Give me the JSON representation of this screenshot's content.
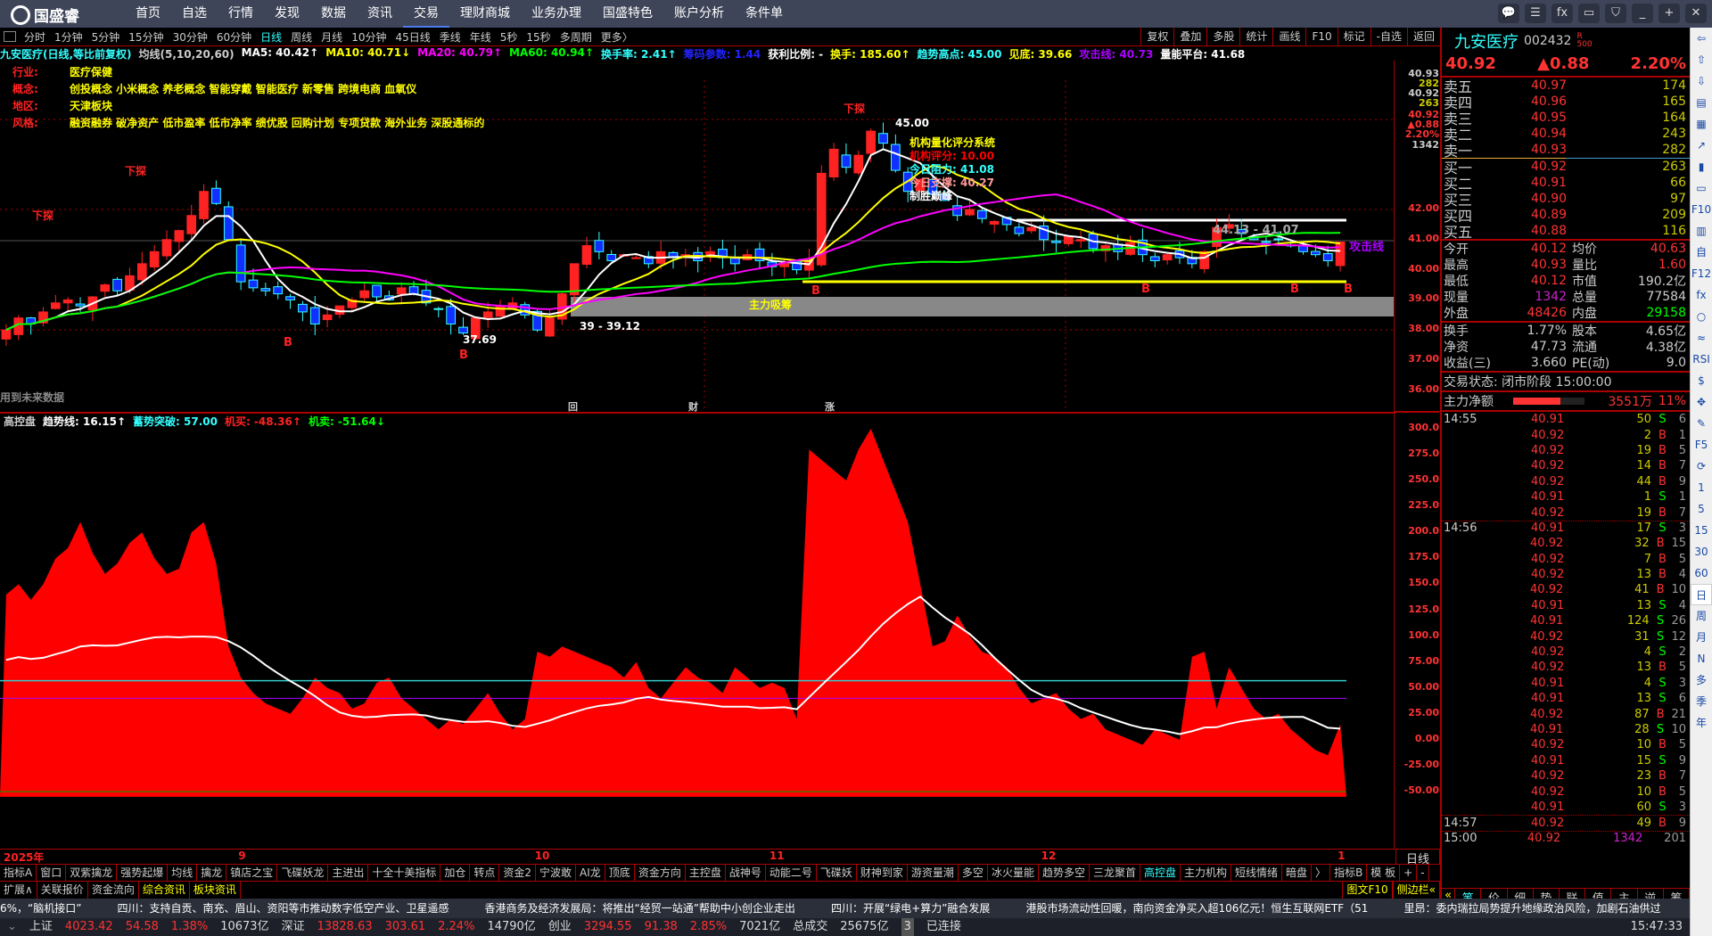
{
  "app": {
    "logo": "国盛睿",
    "nav": [
      "首页",
      "自选",
      "行情",
      "发现",
      "数据",
      "资讯",
      "交易",
      "理财商城",
      "业务办理",
      "国盛特色",
      "账户分析",
      "条件单"
    ],
    "active_nav": 6,
    "window_buttons": [
      "chat-icon",
      "settings-icon",
      "fx-icon",
      "monitor-icon",
      "shirt-icon",
      "minimize-icon",
      "restore-icon",
      "close-icon"
    ]
  },
  "periods": {
    "items": [
      "分时",
      "1分钟",
      "5分钟",
      "15分钟",
      "30分钟",
      "60分钟",
      "日线",
      "周线",
      "月线",
      "10分钟",
      "45日线",
      "季线",
      "年线",
      "5秒",
      "15秒",
      "多周期",
      "更多〉"
    ],
    "active": 6
  },
  "tools": [
    "复权",
    "叠加",
    "多股",
    "统计",
    "画线",
    "F10",
    "标记",
    "-自选",
    "返回"
  ],
  "infoline": [
    {
      "t": "九安医疗(日线,等比前复权)",
      "c": "#3ff"
    },
    {
      "t": "均线(5,10,20,60)",
      "c": "#ccc"
    },
    {
      "t": "MA5: 40.42↑",
      "c": "#fff"
    },
    {
      "t": "MA10: 40.71↓",
      "c": "#ff0"
    },
    {
      "t": "MA20: 40.79↑",
      "c": "#f0f"
    },
    {
      "t": "MA60: 40.94↑",
      "c": "#0f0"
    },
    {
      "t": "换手率: 2.41↑",
      "c": "#3ff"
    },
    {
      "t": "筹码参数: 1.44",
      "c": "#22f"
    },
    {
      "t": "获利比例: -",
      "c": "#fff"
    },
    {
      "t": "换手: 185.60↑",
      "c": "#ff0"
    },
    {
      "t": "趋势高点: 45.00",
      "c": "#3ff"
    },
    {
      "t": "见底: 39.66",
      "c": "#ff0"
    },
    {
      "t": "攻击线: 40.73",
      "c": "#a0f"
    },
    {
      "t": "量能平台: 41.68",
      "c": "#fff"
    }
  ],
  "tags": [
    {
      "k": "行业:",
      "v": "医疗保健"
    },
    {
      "k": "概念:",
      "v": "创投概念 小米概念 养老概念 智能穿戴 智能医疗 新零售 跨境电商 血氧仪"
    },
    {
      "k": "地区:",
      "v": "天津板块"
    },
    {
      "k": "风格:",
      "v": "融资融券 破净资产 低市盈率 低市净率 绩优股 回购计划 专项贷款 海外业务 深股通标的"
    }
  ],
  "annotations": {
    "probe1": "下探",
    "probe2": "下探",
    "probe3": "下探",
    "high": "45.00",
    "low1": "37.69",
    "low2": "39 - 39.12",
    "range": "44.13 - 41.07",
    "accumulate": "主力吸筹",
    "attack": "攻击线",
    "future": "用到未来数据",
    "buy": "B",
    "score": {
      "title": "机构量化评分系统",
      "l1": "机构评分:",
      "v1": "10.00",
      "l2": "今日阻力:",
      "v2": "41.08",
      "l3": "今日支撑:",
      "v3": "40.27",
      "l4": "制胜巅峰"
    },
    "event_icons": [
      "回",
      "财",
      "涨"
    ]
  },
  "price_axis": {
    "top": [
      "40.93",
      "282",
      "40.92",
      "263",
      "40.92",
      "▲0.88",
      "2.20%",
      "1342"
    ],
    "ticks": [
      "42.00",
      "41.00",
      "40.00",
      "39.00",
      "38.00",
      "37.00",
      "36.00"
    ]
  },
  "sub": {
    "header": [
      {
        "t": "高控盘",
        "c": "#ccc"
      },
      {
        "t": "趋势线: 16.15↑",
        "c": "#fff"
      },
      {
        "t": "蓄势突破: 57.00",
        "c": "#3ff"
      },
      {
        "t": "机买: -48.36↑",
        "c": "#f22"
      },
      {
        "t": "机卖: -51.64↓",
        "c": "#0f0"
      }
    ],
    "ticks": [
      "300.0",
      "275.0",
      "250.0",
      "225.0",
      "200.0",
      "175.0",
      "150.0",
      "125.0",
      "100.0",
      "75.00",
      "50.00",
      "25.00",
      "0.00",
      "-25.00",
      "-50.00"
    ]
  },
  "chart_data": {
    "type": "candlestick",
    "ylim": [
      36,
      45.5
    ],
    "closes": [
      38.0,
      38.4,
      38.2,
      38.6,
      38.9,
      39.0,
      38.8,
      39.1,
      39.5,
      39.3,
      39.8,
      40.2,
      40.6,
      41.0,
      41.3,
      41.8,
      42.6,
      42.2,
      41.0,
      39.6,
      39.4,
      39.3,
      39.2,
      39.0,
      38.6,
      38.2,
      38.5,
      38.8,
      39.0,
      39.3,
      39.1,
      39.0,
      39.4,
      39.2,
      38.9,
      38.7,
      38.2,
      37.9,
      38.4,
      38.6,
      38.8,
      38.9,
      38.5,
      38.0,
      38.4,
      39.2,
      40.2,
      40.8,
      40.6,
      40.3,
      40.5,
      40.4,
      40.2,
      40.6,
      40.4,
      40.5,
      40.3,
      40.6,
      40.4,
      40.2,
      40.5,
      40.3,
      40.1,
      40.2,
      40.0,
      40.3,
      43.2,
      44.0,
      43.4,
      43.8,
      44.6,
      44.2,
      43.3,
      42.6,
      43.0,
      42.5,
      42.3,
      41.8,
      42.0,
      41.7,
      41.6,
      41.5,
      41.2,
      41.4,
      41.0,
      40.9,
      41.1,
      41.0,
      40.7,
      40.8,
      40.6,
      40.9,
      40.5,
      40.3,
      40.5,
      40.4,
      40.2,
      40.6,
      41.4,
      41.5,
      41.2,
      41.0,
      40.9,
      41.0,
      40.8,
      40.6,
      40.5,
      40.3,
      40.92
    ],
    "indicator": {
      "ylim": [
        -55,
        310
      ],
      "signal": 57,
      "values": [
        140,
        150,
        135,
        150,
        175,
        185,
        210,
        180,
        160,
        170,
        190,
        200,
        175,
        160,
        165,
        200,
        210,
        170,
        90,
        60,
        45,
        35,
        30,
        25,
        40,
        60,
        50,
        45,
        30,
        35,
        55,
        60,
        40,
        30,
        20,
        10,
        20,
        15,
        30,
        45,
        25,
        10,
        20,
        85,
        80,
        90,
        85,
        80,
        75,
        70,
        60,
        75,
        50,
        40,
        55,
        70,
        60,
        55,
        45,
        70,
        60,
        50,
        55,
        50,
        20,
        280,
        270,
        260,
        250,
        280,
        300,
        270,
        240,
        210,
        150,
        90,
        95,
        120,
        100,
        85,
        80,
        70,
        50,
        35,
        40,
        45,
        30,
        20,
        25,
        10,
        5,
        0,
        -5,
        10,
        5,
        0,
        80,
        85,
        30,
        70,
        50,
        30,
        20,
        25,
        10,
        0,
        -10,
        -15,
        15
      ]
    },
    "months": [
      {
        "label": "2025年",
        "i": 0
      },
      {
        "label": "9",
        "i": 19
      },
      {
        "label": "10",
        "i": 43
      },
      {
        "label": "11",
        "i": 62
      },
      {
        "label": "12",
        "i": 84
      },
      {
        "label": "1",
        "i": 108
      }
    ]
  },
  "period_label": "日线",
  "quote": {
    "name": "九安医疗",
    "code": "002432",
    "tag_r": "R",
    "tag_n": "500",
    "price": "40.92",
    "change": "▲0.88",
    "pct": "2.20%",
    "asks": [
      [
        "卖五",
        "40.97",
        "174"
      ],
      [
        "卖四",
        "40.96",
        "165"
      ],
      [
        "卖三",
        "40.95",
        "164"
      ],
      [
        "卖二",
        "40.94",
        "243"
      ],
      [
        "卖一",
        "40.93",
        "282"
      ]
    ],
    "bids": [
      [
        "买一",
        "40.92",
        "263"
      ],
      [
        "买二",
        "40.91",
        "66"
      ],
      [
        "买三",
        "40.90",
        "97"
      ],
      [
        "买四",
        "40.89",
        "209"
      ],
      [
        "买五",
        "40.88",
        "116"
      ]
    ],
    "stats": [
      [
        "今开",
        "40.12",
        "均价",
        "40.63"
      ],
      [
        "最高",
        "40.93",
        "量比",
        "1.60"
      ],
      [
        "最低",
        "40.12",
        "市值",
        "190.2亿"
      ],
      [
        "现量",
        "1342",
        "总量",
        "77584"
      ],
      [
        "外盘",
        "48426",
        "内盘",
        "29158"
      ]
    ],
    "stats2": [
      [
        "换手",
        "1.77%",
        "股本",
        "4.65亿"
      ],
      [
        "净资",
        "47.73",
        "流通",
        "4.38亿"
      ],
      [
        "收益(三)",
        "3.660",
        "PE(动)",
        "9.0"
      ]
    ],
    "trade_state": "交易状态: 闭市阶段 15:00:00",
    "main_label": "主力净额",
    "main_value": "3551万",
    "main_pct": "11%",
    "main_ratio": 0.11
  },
  "ticks": [
    [
      "14:55",
      "40.91",
      "50",
      "S",
      "6"
    ],
    [
      "",
      "40.92",
      "2",
      "B",
      "1"
    ],
    [
      "",
      "40.92",
      "19",
      "B",
      "5"
    ],
    [
      "",
      "40.92",
      "14",
      "B",
      "7"
    ],
    [
      "",
      "40.92",
      "44",
      "B",
      "9"
    ],
    [
      "",
      "40.91",
      "1",
      "S",
      "1"
    ],
    [
      "",
      "40.92",
      "19",
      "B",
      "7"
    ],
    [
      "14:56",
      "40.91",
      "17",
      "S",
      "3"
    ],
    [
      "",
      "40.92",
      "32",
      "B",
      "15"
    ],
    [
      "",
      "40.92",
      "7",
      "B",
      "5"
    ],
    [
      "",
      "40.92",
      "13",
      "B",
      "4"
    ],
    [
      "",
      "40.92",
      "41",
      "B",
      "10"
    ],
    [
      "",
      "40.91",
      "13",
      "S",
      "4"
    ],
    [
      "",
      "40.91",
      "124",
      "S",
      "26"
    ],
    [
      "",
      "40.92",
      "31",
      "S",
      "12"
    ],
    [
      "",
      "40.92",
      "4",
      "S",
      "2"
    ],
    [
      "",
      "40.92",
      "13",
      "B",
      "5"
    ],
    [
      "",
      "40.91",
      "4",
      "S",
      "3"
    ],
    [
      "",
      "40.91",
      "13",
      "S",
      "6"
    ],
    [
      "",
      "40.92",
      "87",
      "B",
      "21"
    ],
    [
      "",
      "40.91",
      "28",
      "S",
      "10"
    ],
    [
      "",
      "40.92",
      "10",
      "B",
      "5"
    ],
    [
      "",
      "40.91",
      "15",
      "S",
      "9"
    ],
    [
      "",
      "40.92",
      "23",
      "B",
      "7"
    ],
    [
      "",
      "40.92",
      "10",
      "B",
      "5"
    ],
    [
      "",
      "40.91",
      "60",
      "S",
      "3"
    ],
    [
      "14:57",
      "40.92",
      "49",
      "B",
      "9"
    ],
    [
      "15:00",
      "40.92",
      "1342",
      "",
      "201"
    ]
  ],
  "panel_tabs": [
    "«",
    "笔",
    "价",
    "细",
    "势",
    "联",
    "值",
    "主",
    "逆",
    "筹"
  ],
  "sidebar": [
    "⇦",
    "⇧",
    "⇩",
    "▤",
    "▦",
    "↗",
    "▮",
    "▭",
    "F10",
    "▥",
    "自",
    "F12",
    "fx",
    "○",
    "≈",
    "RSI",
    "$",
    "✥",
    "✎",
    "F5",
    "⟳",
    "1",
    "5",
    "15",
    "30",
    "60",
    "日",
    "周",
    "月",
    "N",
    "多",
    "季",
    "年"
  ],
  "ind_tabs": [
    "指标A",
    "窗口",
    "双紫擒龙",
    "强势起爆",
    "均线",
    "擒龙",
    "镇店之宝",
    "飞碟妖龙",
    "主进出",
    "十全十美指标",
    "加仓",
    "转点",
    "资金2",
    "宁波敢",
    "AI龙",
    "顶底",
    "资金方向",
    "主控盘",
    "战神号",
    "动能二号",
    "飞碟妖",
    "财神到家",
    "游资量潮",
    "多空",
    "冰火量能",
    "趋势多空",
    "三龙聚首",
    "高控盘",
    "主力机构",
    "短线情绪",
    "暗盘",
    "〉",
    "指标B",
    "模 板",
    "+",
    "-"
  ],
  "ind_active": 27,
  "ext_tabs": [
    "扩展∧",
    "关联报价",
    "资金流向",
    "综合资讯",
    "板块资讯"
  ],
  "ext_right": [
    "图文F10",
    "侧边栏«"
  ],
  "news": [
    "6%，“脑机接口”",
    "四川：支持自贡、南充、眉山、资阳等市推动数字低空产业、卫星遥感",
    "香港商务及经济发展局：将推出“经贸一站通”帮助中小创企业走出",
    "四川：开展“绿电+算力”融合发展",
    "港股市场流动性回暖，南向资金净买入超106亿元！恒生互联网ETF（51",
    "里昂：委内瑞拉局势提升地缘政治风险，加剧石油供过"
  ],
  "status": {
    "sh": [
      "上证",
      "4023.42",
      "54.58",
      "1.38%",
      "10673亿"
    ],
    "sz": [
      "深证",
      "13828.63",
      "303.61",
      "2.24%",
      "14790亿"
    ],
    "cy": [
      "创业",
      "3294.55",
      "91.38",
      "2.85%",
      "7021亿"
    ],
    "total_label": "总成交",
    "total": "25675亿",
    "conn_count": "3",
    "conn": "已连接",
    "time": "15:47:33"
  }
}
